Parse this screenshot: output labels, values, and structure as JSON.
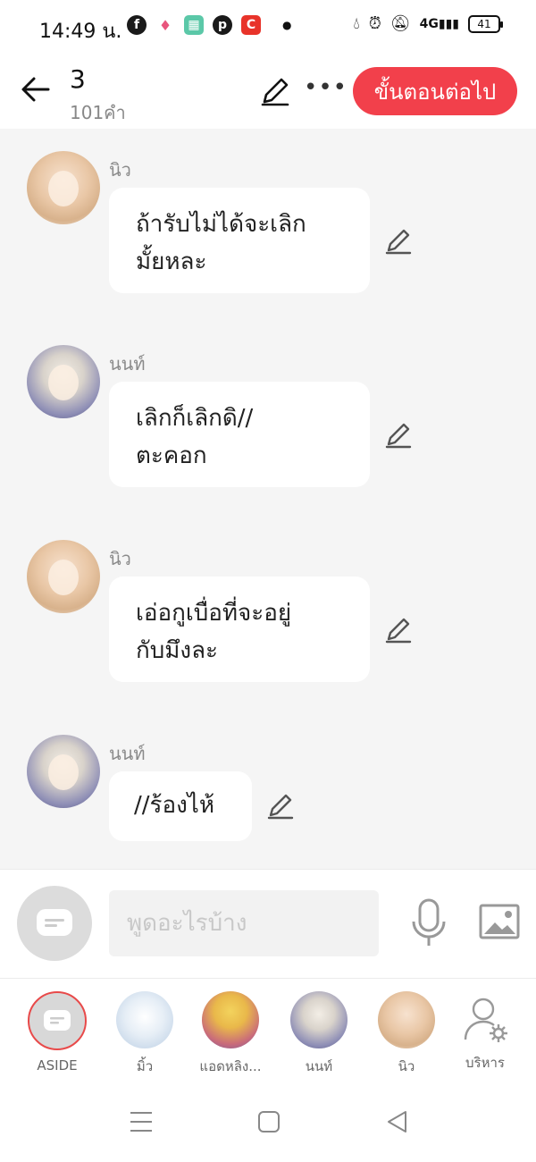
{
  "status_bar": {
    "time": "14:49 น.",
    "battery": "41",
    "app_icons": [
      "facebook-icon",
      "tinder-icon",
      "calculator-icon",
      "pinterest-icon",
      "c-app-icon"
    ],
    "system_icons": [
      "drop-icon",
      "alarm-icon",
      "mute-icon",
      "4g-signal-icon"
    ]
  },
  "header": {
    "title": "3",
    "word_count": "101คำ",
    "next_button": "ขั้นตอนต่อไป",
    "accent_color": "#f2404b"
  },
  "messages": [
    {
      "sender": "นิว",
      "text": "ถ้ารับไม่ได้จะเลิก\nมั้ยหละ"
    },
    {
      "sender": "นนท์",
      "text": "เลิกก็เลิกดิ//\nตะคอก"
    },
    {
      "sender": "นิว",
      "text": "เอ่อกูเบื่อที่จะอยู่\nกับมึงละ"
    },
    {
      "sender": "นนท์",
      "text": "//ร้องไห้"
    }
  ],
  "input": {
    "placeholder": "พูดอะไรบ้าง"
  },
  "characters": [
    {
      "label": "ASIDE"
    },
    {
      "label": "มิ้ว"
    },
    {
      "label": "แอดหลิง..."
    },
    {
      "label": "นนท์"
    },
    {
      "label": "นิว"
    },
    {
      "label": "บริหาร"
    }
  ]
}
